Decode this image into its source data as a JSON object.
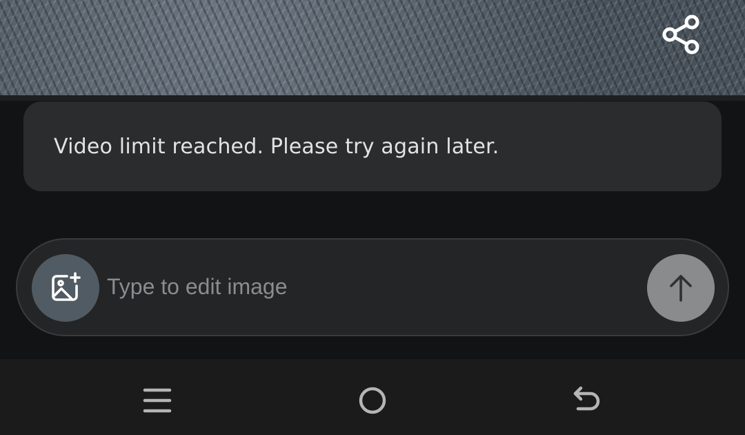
{
  "preview": {
    "share_icon": "share-icon"
  },
  "message": {
    "text": "Video limit reached. Please try again later."
  },
  "composer": {
    "add_image_icon": "add-image-icon",
    "input_value": "",
    "input_placeholder": "Type to edit image",
    "send_icon": "arrow-up-icon"
  },
  "nav_bar": {
    "recents_icon": "recents-icon",
    "home_icon": "home-icon",
    "back_icon": "back-icon"
  },
  "colors": {
    "background": "#121314",
    "card": "#2b2c2e",
    "input_bar": "#242526",
    "add_image_button": "#515b63",
    "send_button": "#8a8b8d"
  }
}
